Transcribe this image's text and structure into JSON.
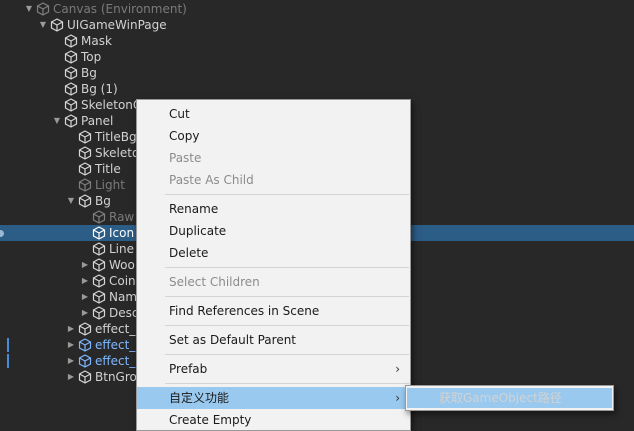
{
  "hierarchy": [
    {
      "label": "Canvas (Environment)",
      "indent": 0,
      "arrow": "down",
      "state": "disabled"
    },
    {
      "label": "UIGameWinPage",
      "indent": 1,
      "arrow": "down",
      "state": "normal"
    },
    {
      "label": "Mask",
      "indent": 2,
      "arrow": "none",
      "state": "normal"
    },
    {
      "label": "Top",
      "indent": 2,
      "arrow": "none",
      "state": "normal"
    },
    {
      "label": "Bg",
      "indent": 2,
      "arrow": "none",
      "state": "normal"
    },
    {
      "label": "Bg (1)",
      "indent": 2,
      "arrow": "none",
      "state": "normal"
    },
    {
      "label": "SkeletonG",
      "indent": 2,
      "arrow": "none",
      "state": "normal"
    },
    {
      "label": "Panel",
      "indent": 2,
      "arrow": "down",
      "state": "normal"
    },
    {
      "label": "TitleBg",
      "indent": 3,
      "arrow": "none",
      "state": "normal"
    },
    {
      "label": "Skeleto",
      "indent": 3,
      "arrow": "none",
      "state": "normal"
    },
    {
      "label": "Title",
      "indent": 3,
      "arrow": "none",
      "state": "normal"
    },
    {
      "label": "Light",
      "indent": 3,
      "arrow": "none",
      "state": "disabled"
    },
    {
      "label": "Bg",
      "indent": 3,
      "arrow": "down",
      "state": "normal"
    },
    {
      "label": "Raw",
      "indent": 4,
      "arrow": "none",
      "state": "disabled"
    },
    {
      "label": "Icon",
      "indent": 4,
      "arrow": "none",
      "state": "selected"
    },
    {
      "label": "Line",
      "indent": 4,
      "arrow": "none",
      "state": "normal"
    },
    {
      "label": "Woo",
      "indent": 4,
      "arrow": "right",
      "state": "normal"
    },
    {
      "label": "Coin",
      "indent": 4,
      "arrow": "right",
      "state": "normal"
    },
    {
      "label": "Nam",
      "indent": 4,
      "arrow": "right",
      "state": "normal"
    },
    {
      "label": "Desc",
      "indent": 4,
      "arrow": "right",
      "state": "normal"
    },
    {
      "label": "effect_",
      "indent": 3,
      "arrow": "right",
      "state": "normal"
    },
    {
      "label": "effect_",
      "indent": 3,
      "arrow": "right",
      "state": "blue"
    },
    {
      "label": "effect_",
      "indent": 3,
      "arrow": "right",
      "state": "blue"
    },
    {
      "label": "BtnGro",
      "indent": 3,
      "arrow": "right",
      "state": "normal"
    }
  ],
  "menu": {
    "cut": "Cut",
    "copy": "Copy",
    "paste": "Paste",
    "paste_as_child": "Paste As Child",
    "rename": "Rename",
    "duplicate": "Duplicate",
    "delete": "Delete",
    "select_children": "Select Children",
    "find_references": "Find References in Scene",
    "set_default_parent": "Set as Default Parent",
    "prefab": "Prefab",
    "custom_function": "自定义功能",
    "create_empty": "Create Empty"
  },
  "submenu": {
    "get_path": "获取GameObject路径"
  },
  "colors": {
    "selected_row": "#2c5d87",
    "menu_highlight": "#99c9ef",
    "blue_text": "#7fb8ff"
  }
}
